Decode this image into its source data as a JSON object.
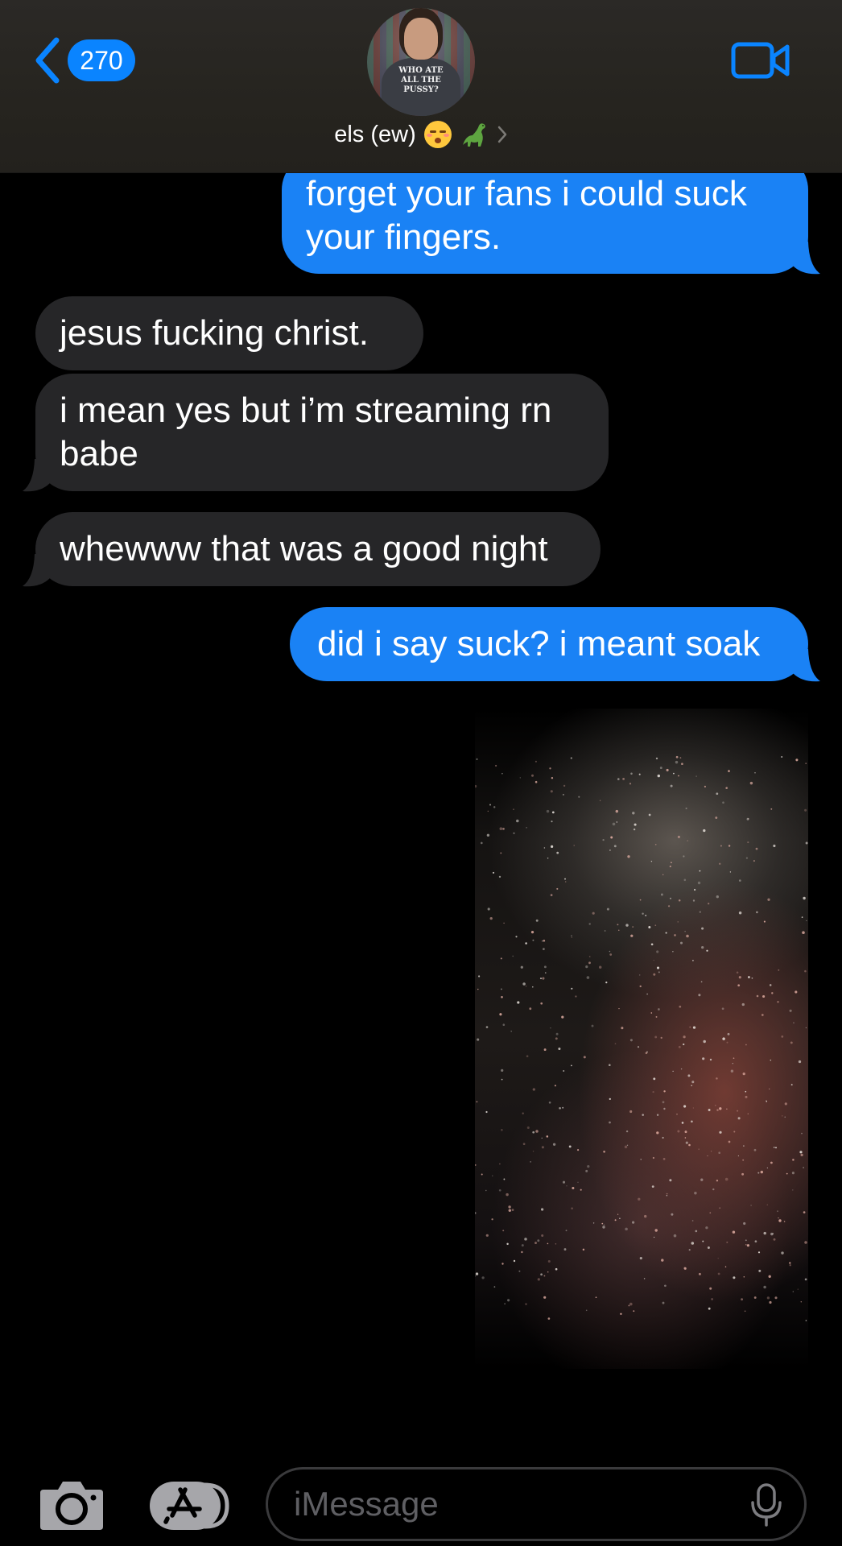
{
  "header": {
    "back_count": "270",
    "contact_name": "els (ew)",
    "avatar_shirt_text": "WHO ATE\nALL THE\nPUSSY?"
  },
  "messages": [
    {
      "direction": "sent",
      "text_line1": "forget your fans i could suck",
      "text_line2": "your fingers."
    },
    {
      "direction": "received",
      "text": "jesus fucking christ."
    },
    {
      "direction": "received",
      "text_line1": "i mean yes but i’m streaming rn",
      "text_line2": "babe"
    },
    {
      "direction": "received",
      "text": "whewww that was a good night"
    },
    {
      "direction": "sent",
      "text": "did i say suck? i meant soak"
    }
  ],
  "composer": {
    "placeholder": "iMessage"
  },
  "colors": {
    "accent": "#0a84ff",
    "sent_bubble": "#1a82f5",
    "received_bubble": "#262628",
    "background": "#000000"
  },
  "icons": [
    "back-chevron-icon",
    "video-camera-icon",
    "kissing-face-emoji",
    "dinosaur-emoji",
    "chevron-right-icon",
    "camera-icon",
    "app-store-icon",
    "microphone-icon"
  ]
}
